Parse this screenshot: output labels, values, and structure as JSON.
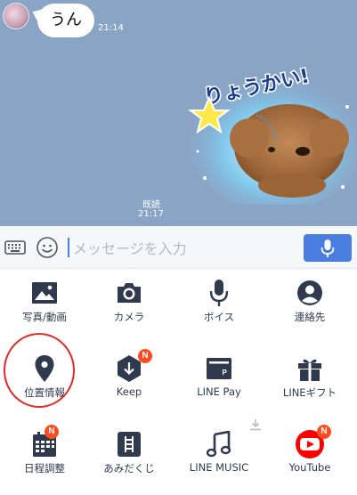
{
  "chat": {
    "message_text": "うん",
    "message_time": "21:14",
    "sticker_caption": "りょうかい!",
    "read_label": "既読",
    "sticker_time": "21:17"
  },
  "input": {
    "placeholder": "メッセージを入力"
  },
  "menu": {
    "items": [
      {
        "label": "写真/動画",
        "icon": "photo-icon"
      },
      {
        "label": "カメラ",
        "icon": "camera-icon"
      },
      {
        "label": "ボイス",
        "icon": "microphone-icon"
      },
      {
        "label": "連絡先",
        "icon": "contact-icon"
      },
      {
        "label": "位置情報",
        "icon": "location-pin-icon"
      },
      {
        "label": "Keep",
        "icon": "keep-icon",
        "badge": "N"
      },
      {
        "label": "LINE Pay",
        "icon": "wallet-icon"
      },
      {
        "label": "LINEギフト",
        "icon": "gift-icon"
      },
      {
        "label": "日程調整",
        "icon": "calendar-icon",
        "badge": "N"
      },
      {
        "label": "あみだくじ",
        "icon": "amidakuji-icon"
      },
      {
        "label": "LINE MUSIC",
        "icon": "music-note-icon"
      },
      {
        "label": "YouTube",
        "icon": "youtube-icon",
        "badge": "N"
      }
    ]
  },
  "colors": {
    "chat_background": "#8aa4c6",
    "accent_blue": "#4a7de0",
    "icon_dark": "#2f3a4e",
    "badge_red": "#ff4b1f",
    "youtube_red": "#ff0000",
    "highlight_red": "#e22a2a"
  }
}
